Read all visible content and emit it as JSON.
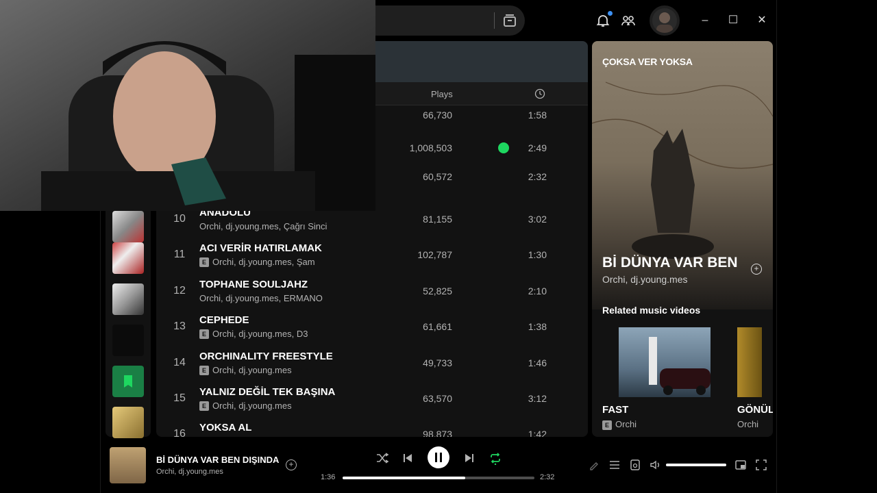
{
  "window": {
    "minimize": "–",
    "maximize": "☐",
    "close": "✕"
  },
  "main": {
    "columns": {
      "plays": "Plays"
    },
    "tracks": [
      {
        "num": "",
        "title": "",
        "artists": "",
        "explicit": false,
        "plays": "66,730",
        "duration": "1:58",
        "saved": false
      },
      {
        "num": "",
        "title": "",
        "artists": "",
        "explicit": false,
        "plays": "1,008,503",
        "duration": "2:49",
        "saved": true
      },
      {
        "num": "",
        "title": "",
        "artists": "",
        "explicit": false,
        "plays": "60,572",
        "duration": "2:32",
        "saved": false
      },
      {
        "num": "10",
        "title": "ANADOLU",
        "artists": "Orchi, dj.young.mes, Çağrı Sinci",
        "explicit": false,
        "plays": "81,155",
        "duration": "3:02",
        "saved": false
      },
      {
        "num": "11",
        "title": "ACI VERİR HATIRLAMAK",
        "artists": "Orchi, dj.young.mes, Şam",
        "explicit": true,
        "plays": "102,787",
        "duration": "1:30",
        "saved": false
      },
      {
        "num": "12",
        "title": "TOPHANE SOULJAHZ",
        "artists": "Orchi, dj.young.mes, ERMANO",
        "explicit": false,
        "plays": "52,825",
        "duration": "2:10",
        "saved": false
      },
      {
        "num": "13",
        "title": "CEPHEDE",
        "artists": "Orchi, dj.young.mes, D3",
        "explicit": true,
        "plays": "61,661",
        "duration": "1:38",
        "saved": false
      },
      {
        "num": "14",
        "title": "ORCHINALITY FREESTYLE",
        "artists": "Orchi, dj.young.mes",
        "explicit": true,
        "plays": "49,733",
        "duration": "1:46",
        "saved": false
      },
      {
        "num": "15",
        "title": "YALNIZ DEĞİL TEK BAŞINA",
        "artists": "Orchi, dj.young.mes",
        "explicit": true,
        "plays": "63,570",
        "duration": "3:12",
        "saved": false
      },
      {
        "num": "16",
        "title": "YOKSA AL",
        "artists": "",
        "explicit": false,
        "plays": "98,873",
        "duration": "1:42",
        "saved": false
      }
    ]
  },
  "right_panel": {
    "canvas_overlay": "ÇOKSA VER YOKSA",
    "song_title": "Bİ DÜNYA VAR BEN DIŞINDA",
    "song_artists": "Orchi, dj.young.mes",
    "related_heading": "Related music videos",
    "videos": [
      {
        "title": "FAST",
        "artist": "Orchi",
        "explicit": true
      },
      {
        "title": "GÖNÜL",
        "artist": "Orchi",
        "explicit": false
      }
    ]
  },
  "player": {
    "title": "Bİ DÜNYA VAR BEN DIŞINDA",
    "artists": "Orchi, dj.young.mes",
    "elapsed": "1:36",
    "total": "2:32",
    "progress_fraction": 0.64,
    "volume_fraction": 1.0,
    "is_playing": true,
    "shuffle": false,
    "repeat": true
  },
  "colors": {
    "accent": "#1ed760",
    "panel_bg": "#121212",
    "notification_dot": "#3d91f4"
  }
}
